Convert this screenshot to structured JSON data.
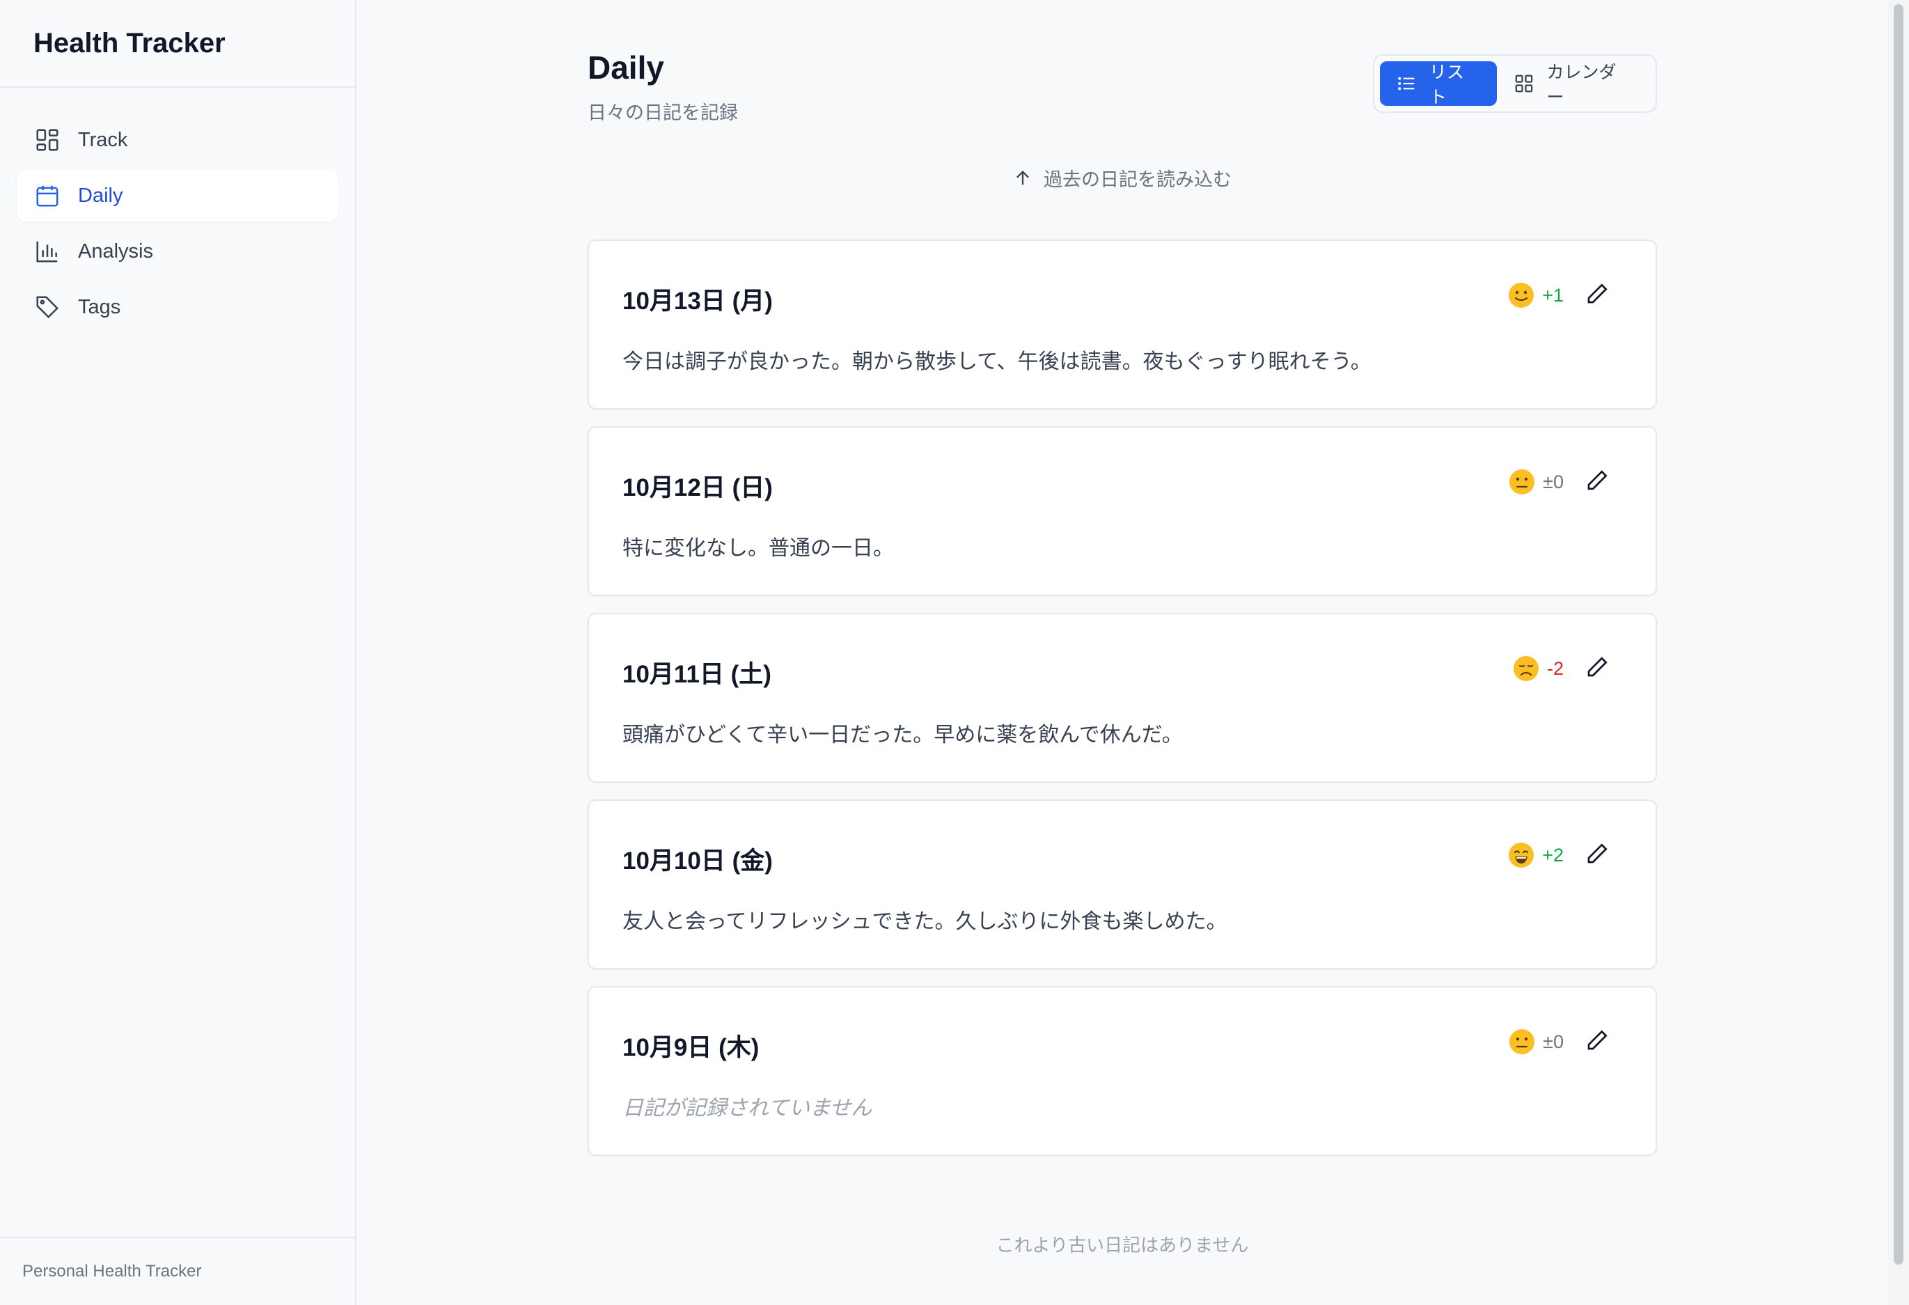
{
  "app": {
    "title": "Health Tracker",
    "footer": "Personal Health Tracker"
  },
  "sidebar": {
    "items": [
      {
        "label": "Track",
        "icon": "dashboard-icon",
        "active": false
      },
      {
        "label": "Daily",
        "icon": "calendar-icon",
        "active": true
      },
      {
        "label": "Analysis",
        "icon": "bar-chart-icon",
        "active": false
      },
      {
        "label": "Tags",
        "icon": "tag-icon",
        "active": false
      }
    ]
  },
  "header": {
    "title": "Daily",
    "subtitle": "日々の日記を記録",
    "view_toggle": {
      "list_label": "リスト",
      "calendar_label": "カレンダー",
      "selected": "リスト"
    }
  },
  "load_past_label": "過去の日記を読み込む",
  "entries": [
    {
      "date": "10月13日 (月)",
      "emoji": "slight-smile-emoji",
      "score": "+1",
      "score_type": "positive",
      "text": "今日は調子が良かった。朝から散歩して、午後は読書。夜もぐっすり眠れそう。"
    },
    {
      "date": "10月12日 (日)",
      "emoji": "neutral-face-emoji",
      "score": "±0",
      "score_type": "neutral",
      "text": "特に変化なし。普通の一日。"
    },
    {
      "date": "10月11日 (土)",
      "emoji": "disappointed-face-emoji",
      "score": "-2",
      "score_type": "negative",
      "text": "頭痛がひどくて辛い一日だった。早めに薬を飲んで休んだ。"
    },
    {
      "date": "10月10日 (金)",
      "emoji": "grinning-face-emoji",
      "score": "+2",
      "score_type": "positive",
      "text": "友人と会ってリフレッシュできた。久しぶりに外食も楽しめた。"
    },
    {
      "date": "10月9日 (木)",
      "emoji": "neutral-face-emoji",
      "score": "±0",
      "score_type": "neutral",
      "text": "日記が記録されていません"
    }
  ],
  "end_note": "これより古い日記はありません",
  "colors": {
    "accent": "#2563eb",
    "positive": "#16a34a",
    "negative": "#dc2626",
    "neutral": "#6b7280"
  }
}
